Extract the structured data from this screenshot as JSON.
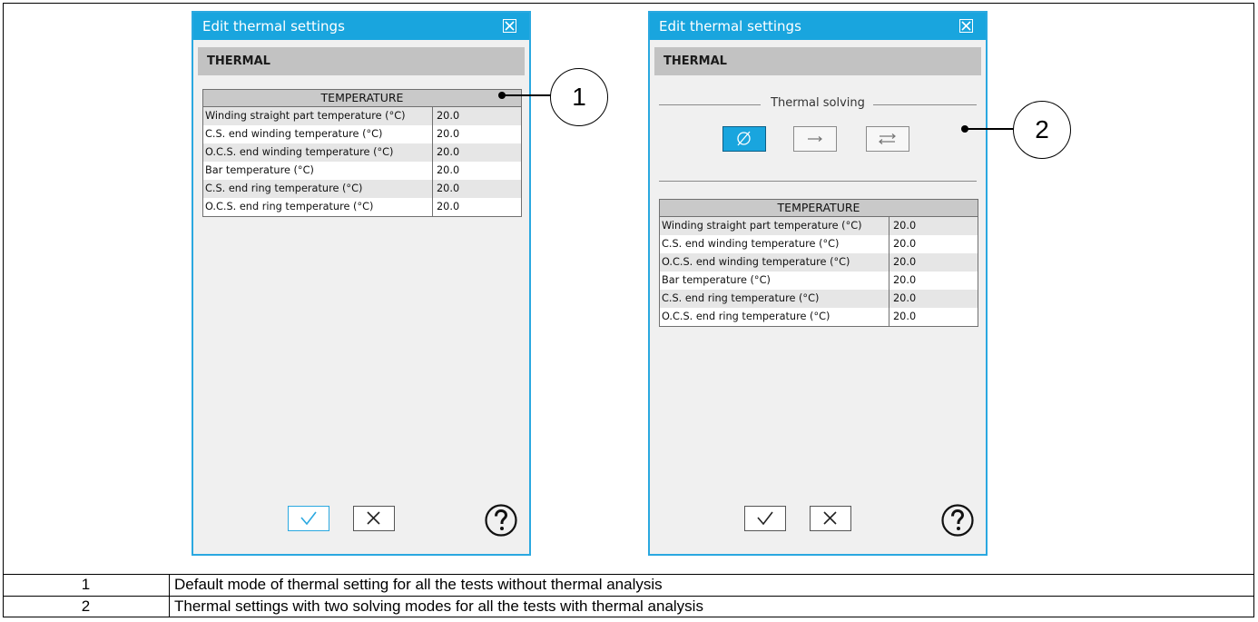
{
  "left_dialog": {
    "title": "Edit thermal settings",
    "section": "THERMAL",
    "table_header": "TEMPERATURE",
    "rows": [
      {
        "label": "Winding straight part temperature (°C)",
        "value": "20.0"
      },
      {
        "label": "C.S. end winding temperature (°C)",
        "value": "20.0"
      },
      {
        "label": "O.C.S. end winding temperature (°C)",
        "value": "20.0"
      },
      {
        "label": "Bar temperature (°C)",
        "value": "20.0"
      },
      {
        "label": "C.S. end ring temperature (°C)",
        "value": "20.0"
      },
      {
        "label": "O.C.S. end ring temperature (°C)",
        "value": "20.0"
      }
    ],
    "ok_button": "check-icon",
    "cancel_button": "x-icon",
    "help_button": "question-icon"
  },
  "right_dialog": {
    "title": "Edit thermal settings",
    "section": "THERMAL",
    "solving_label": "Thermal solving",
    "modes": [
      "empty-set-icon",
      "arrow-right-icon",
      "arrows-exchange-icon"
    ],
    "selected_mode": "empty-set-icon",
    "table_header": "TEMPERATURE",
    "rows": [
      {
        "label": "Winding straight part temperature (°C)",
        "value": "20.0"
      },
      {
        "label": "C.S. end winding temperature (°C)",
        "value": "20.0"
      },
      {
        "label": "O.C.S. end winding temperature (°C)",
        "value": "20.0"
      },
      {
        "label": "Bar temperature (°C)",
        "value": "20.0"
      },
      {
        "label": "C.S. end ring temperature (°C)",
        "value": "20.0"
      },
      {
        "label": "O.C.S. end ring temperature (°C)",
        "value": "20.0"
      }
    ]
  },
  "callouts": [
    "1",
    "2"
  ],
  "legend": [
    {
      "num": "1",
      "text": "Default mode of thermal setting for all the tests without thermal analysis"
    },
    {
      "num": "2",
      "text": "Thermal settings with two solving modes for all the tests with thermal analysis"
    }
  ],
  "colors": {
    "title_bar": "#19a5de",
    "selected": "#19a5de",
    "section": "#c2c2c2"
  }
}
